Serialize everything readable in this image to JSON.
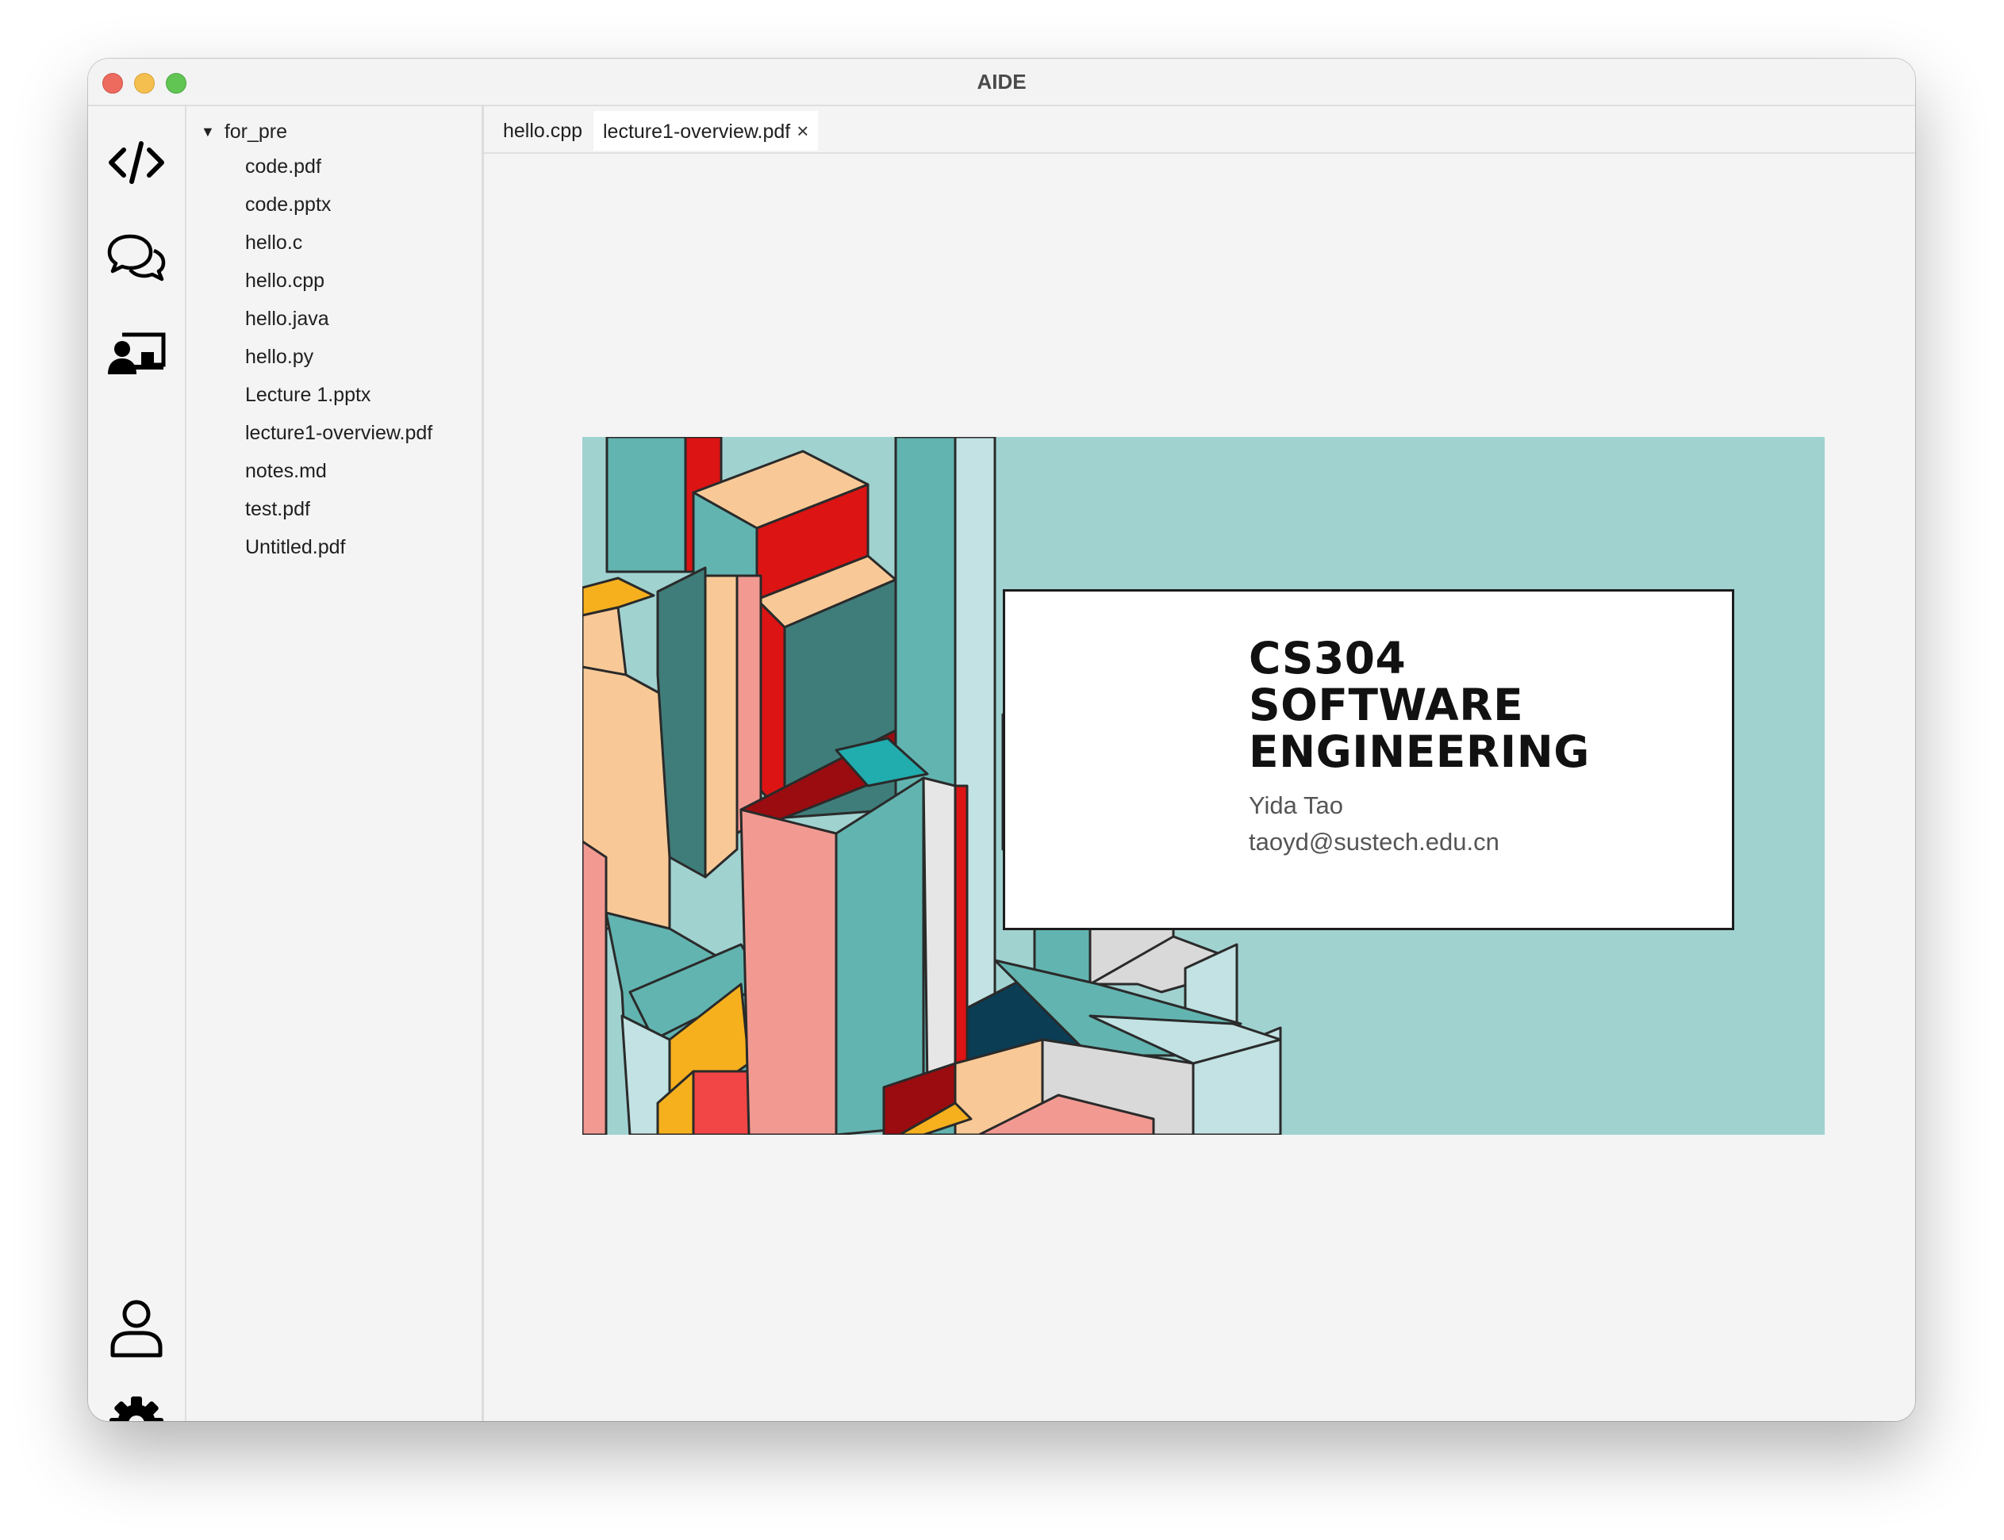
{
  "window": {
    "title": "AIDE"
  },
  "activity_bar": {
    "top_icons": [
      "code-icon",
      "chat-icon",
      "presentation-icon"
    ],
    "bottom_icons": [
      "account-icon",
      "settings-icon"
    ]
  },
  "explorer": {
    "folder": "for_pre",
    "files": [
      "code.pdf",
      "code.pptx",
      "hello.c",
      "hello.cpp",
      "hello.java",
      "hello.py",
      "Lecture 1.pptx",
      "lecture1-overview.pdf",
      "notes.md",
      "test.pdf",
      "Untitled.pdf"
    ]
  },
  "tabs": [
    {
      "label": "hello.cpp",
      "active": false
    },
    {
      "label": "lecture1-overview.pdf",
      "active": true,
      "close": "×"
    }
  ],
  "slide": {
    "title": "CS304\nSOFTWARE\nENGINEERING",
    "author": "Yida Tao",
    "email": "taoyd@sustech.edu.cn"
  },
  "colors": {
    "slide_background": "#a0d2d0",
    "teal": "#62b4b0",
    "dark_teal": "#3f7d7a",
    "peach": "#f8c997",
    "red": "#dc1414",
    "dark_red": "#9a0c10",
    "pink": "#f29a92",
    "orange": "#f6b01e",
    "light_gray": "#d9d9d9"
  }
}
